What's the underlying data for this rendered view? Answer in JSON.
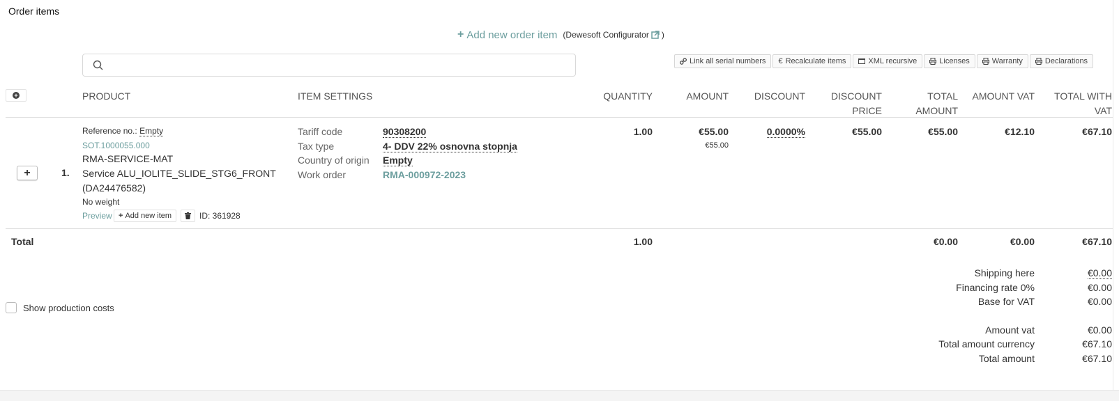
{
  "section_title": "Order items",
  "add_order": {
    "label": "Add new order item",
    "configurator": "(Dewesoft Configurator"
  },
  "search": {
    "placeholder": ""
  },
  "toolbar": [
    {
      "label": "Link all serial numbers",
      "icon": "link-icon"
    },
    {
      "label": "Recalculate items",
      "icon": "euro-icon"
    },
    {
      "label": "XML recursive",
      "icon": "xml-icon"
    },
    {
      "label": "Licenses",
      "icon": "print-icon"
    },
    {
      "label": "Warranty",
      "icon": "print-icon"
    },
    {
      "label": "Declarations",
      "icon": "print-icon"
    }
  ],
  "columns": {
    "product": "PRODUCT",
    "item_settings": "ITEM SETTINGS",
    "quantity": "QUANTITY",
    "amount": "AMOUNT",
    "discount": "DISCOUNT",
    "discount_price_1": "DISCOUNT",
    "discount_price_2": "PRICE",
    "total_amount_1": "TOTAL",
    "total_amount_2": "AMOUNT",
    "amount_vat": "AMOUNT VAT",
    "total_with_vat_1": "TOTAL WITH",
    "total_with_vat_2": "VAT"
  },
  "item": {
    "number": "1.",
    "reference_label": "Reference no.:",
    "reference_value": "Empty",
    "sot": "SOT.1000055.000",
    "code": "RMA-SERVICE-MAT",
    "name_line1": "Service ALU_IOLITE_SLIDE_STG6_FRONT",
    "name_line2": "(DA24476582)",
    "weight": "No weight",
    "preview": "Preview",
    "add_new_item": "Add new item",
    "id": "ID: 361928",
    "settings": [
      {
        "label": "Tariff code",
        "value": "90308200"
      },
      {
        "label": "Tax type",
        "value": "4- DDV 22% osnovna stopnja"
      },
      {
        "label": "Country of origin",
        "value": "Empty"
      },
      {
        "label": "Work order",
        "value": "RMA-000972-2023"
      }
    ],
    "quantity": "1.00",
    "amount": "€55.00",
    "amount_sub": "€55.00",
    "discount": "0.0000%",
    "discount_price": "€55.00",
    "total_amount": "€55.00",
    "amount_vat": "€12.10",
    "total_with_vat": "€67.10"
  },
  "total_row": {
    "label": "Total",
    "quantity": "1.00",
    "total_amount": "€0.00",
    "amount_vat": "€0.00",
    "total_with_vat": "€67.10"
  },
  "summary": [
    {
      "label": "Shipping here",
      "value": "€0.00"
    },
    {
      "label": "Financing rate 0%",
      "value": "€0.00"
    },
    {
      "label": "Base for VAT",
      "value": "€0.00"
    },
    {
      "label": "Amount vat",
      "value": "€0.00"
    },
    {
      "label": "Total amount currency",
      "value": "€67.10"
    },
    {
      "label": "Total amount",
      "value": "€67.10"
    }
  ],
  "show_production_costs": "Show production costs",
  "colors": {
    "accent": "#6c9e9e",
    "border": "#dddddd"
  }
}
